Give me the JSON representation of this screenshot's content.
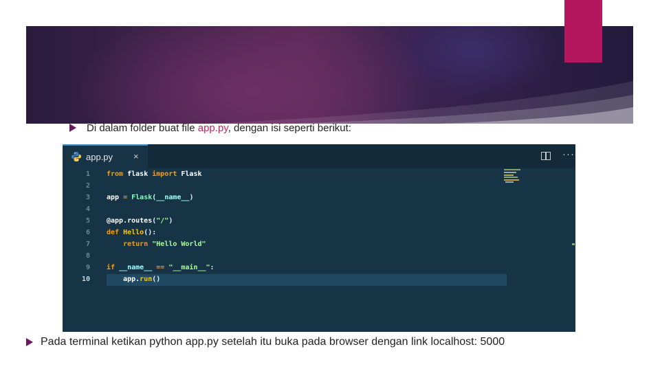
{
  "slide": {
    "bullet1": {
      "prefix": "Di dalam folder buat file ",
      "filename": "app.py",
      "suffix": ", dengan isi seperti berikut:"
    },
    "bullet2": "Pada terminal ketikan python app.py setelah itu buka pada browser dengan link localhost: 5000"
  },
  "editor": {
    "tab_label": "app.py",
    "tab_close": "×",
    "more_label": "···",
    "active_line": 10,
    "line_numbers": [
      "1",
      "2",
      "3",
      "4",
      "5",
      "6",
      "7",
      "8",
      "9",
      "10"
    ],
    "code_lines": [
      [
        {
          "t": "from",
          "c": "kw"
        },
        {
          "t": " flask ",
          "c": "plain"
        },
        {
          "t": "import",
          "c": "kw"
        },
        {
          "t": " Flask",
          "c": "plain"
        }
      ],
      [],
      [
        {
          "t": "app ",
          "c": "plain"
        },
        {
          "t": "=",
          "c": "op"
        },
        {
          "t": " Flask",
          "c": "cls"
        },
        {
          "t": "(",
          "c": "punc"
        },
        {
          "t": "__name__",
          "c": "dunder"
        },
        {
          "t": ")",
          "c": "punc"
        }
      ],
      [],
      [
        {
          "t": "@app.routes",
          "c": "dec"
        },
        {
          "t": "(",
          "c": "punc"
        },
        {
          "t": "\"/\"",
          "c": "str"
        },
        {
          "t": ")",
          "c": "punc"
        }
      ],
      [
        {
          "t": "def",
          "c": "kw"
        },
        {
          "t": " Hello",
          "c": "fn"
        },
        {
          "t": "():",
          "c": "punc"
        }
      ],
      [
        {
          "t": "    ",
          "c": "plain"
        },
        {
          "t": "return",
          "c": "kw"
        },
        {
          "t": " \"Hello World\"",
          "c": "str"
        }
      ],
      [],
      [
        {
          "t": "if",
          "c": "kw"
        },
        {
          "t": " __name__ ",
          "c": "dunder"
        },
        {
          "t": "==",
          "c": "op"
        },
        {
          "t": " \"__main__\"",
          "c": "str"
        },
        {
          "t": ":",
          "c": "punc"
        }
      ],
      [
        {
          "t": "    app.",
          "c": "plain"
        },
        {
          "t": "run",
          "c": "fn"
        },
        {
          "t": "()",
          "c": "punc"
        }
      ]
    ]
  },
  "colors": {
    "accent": "#b5175e",
    "bullet": "#6b1a60",
    "highlight": "#c0255e",
    "editor_bg": "#173447"
  }
}
